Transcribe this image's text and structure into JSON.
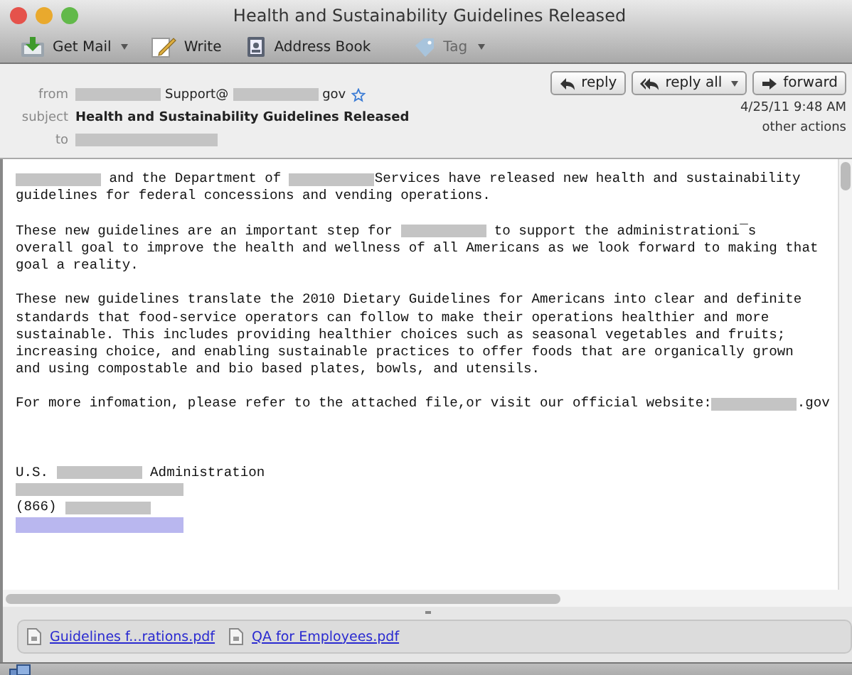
{
  "window": {
    "title": "Health and Sustainability Guidelines Released"
  },
  "toolbar": [
    {
      "kind": "getmail",
      "label": "Get Mail",
      "dropdown": true
    },
    {
      "kind": "write",
      "label": "Write",
      "dropdown": false
    },
    {
      "kind": "addressbook",
      "label": "Address Book",
      "dropdown": false
    },
    {
      "kind": "tag",
      "label": "Tag",
      "dropdown": true
    }
  ],
  "header": {
    "from_label": "from",
    "from_parts": [
      {
        "kind": "redacted"
      },
      {
        "kind": "text",
        "text": "Support@"
      },
      {
        "kind": "redacted"
      },
      {
        "kind": "text",
        "text": "gov"
      }
    ],
    "subject_label": "subject",
    "subject": "Health and Sustainability Guidelines Released",
    "to_label": "to",
    "date": "4/25/11 9:48 AM",
    "other_actions": "other actions",
    "buttons": [
      {
        "kind": "reply",
        "label": "reply",
        "dropdown": false
      },
      {
        "kind": "replyall",
        "label": "reply all",
        "dropdown": true
      },
      {
        "kind": "forward",
        "label": "forward",
        "dropdown": false
      }
    ]
  },
  "body": [
    {
      "lines": [
        [
          {
            "kind": "redacted"
          },
          {
            "kind": "text",
            "text": " and the Department of "
          },
          {
            "kind": "redacted"
          },
          {
            "kind": "text",
            "text": "Services have released new health and sustainability"
          }
        ],
        [
          {
            "kind": "text",
            "text": "guidelines for federal concessions and vending operations."
          }
        ]
      ]
    },
    {
      "lines": [
        [
          {
            "kind": "text",
            "text": "These new guidelines are an important step for "
          },
          {
            "kind": "redacted"
          },
          {
            "kind": "text",
            "text": " to support the administrationi¯s"
          }
        ],
        [
          {
            "kind": "text",
            "text": "overall goal to improve the health and wellness of all Americans as we look forward to making that"
          }
        ],
        [
          {
            "kind": "text",
            "text": "goal a reality."
          }
        ]
      ]
    },
    {
      "lines": [
        [
          {
            "kind": "text",
            "text": "These new guidelines translate the 2010 Dietary Guidelines for Americans into clear and definite"
          }
        ],
        [
          {
            "kind": "text",
            "text": "standards that food-service operators can follow to make their operations healthier and more"
          }
        ],
        [
          {
            "kind": "text",
            "text": "sustainable. This includes providing healthier choices such as seasonal vegetables and fruits;"
          }
        ],
        [
          {
            "kind": "text",
            "text": "increasing choice, and enabling sustainable practices to offer foods that are organically grown"
          }
        ],
        [
          {
            "kind": "text",
            "text": "and using compostable and bio based plates, bowls, and utensils."
          }
        ]
      ]
    },
    {
      "lines": [
        [
          {
            "kind": "text",
            "text": "For more infomation, please refer to the attached file,or visit our official website:"
          },
          {
            "kind": "redacted"
          },
          {
            "kind": "text",
            "text": ".gov"
          }
        ]
      ]
    }
  ],
  "signature": [
    [
      {
        "kind": "text",
        "text": "U.S. "
      },
      {
        "kind": "redacted"
      },
      {
        "kind": "text",
        "text": " Administration"
      }
    ],
    [
      {
        "kind": "redacted"
      }
    ],
    [
      {
        "kind": "text",
        "text": "(866) "
      },
      {
        "kind": "redacted"
      }
    ],
    [
      {
        "kind": "link-redacted"
      }
    ]
  ],
  "attachments": [
    {
      "name": "Guidelines f...rations.pdf"
    },
    {
      "name": "QA for Employees.pdf"
    }
  ]
}
